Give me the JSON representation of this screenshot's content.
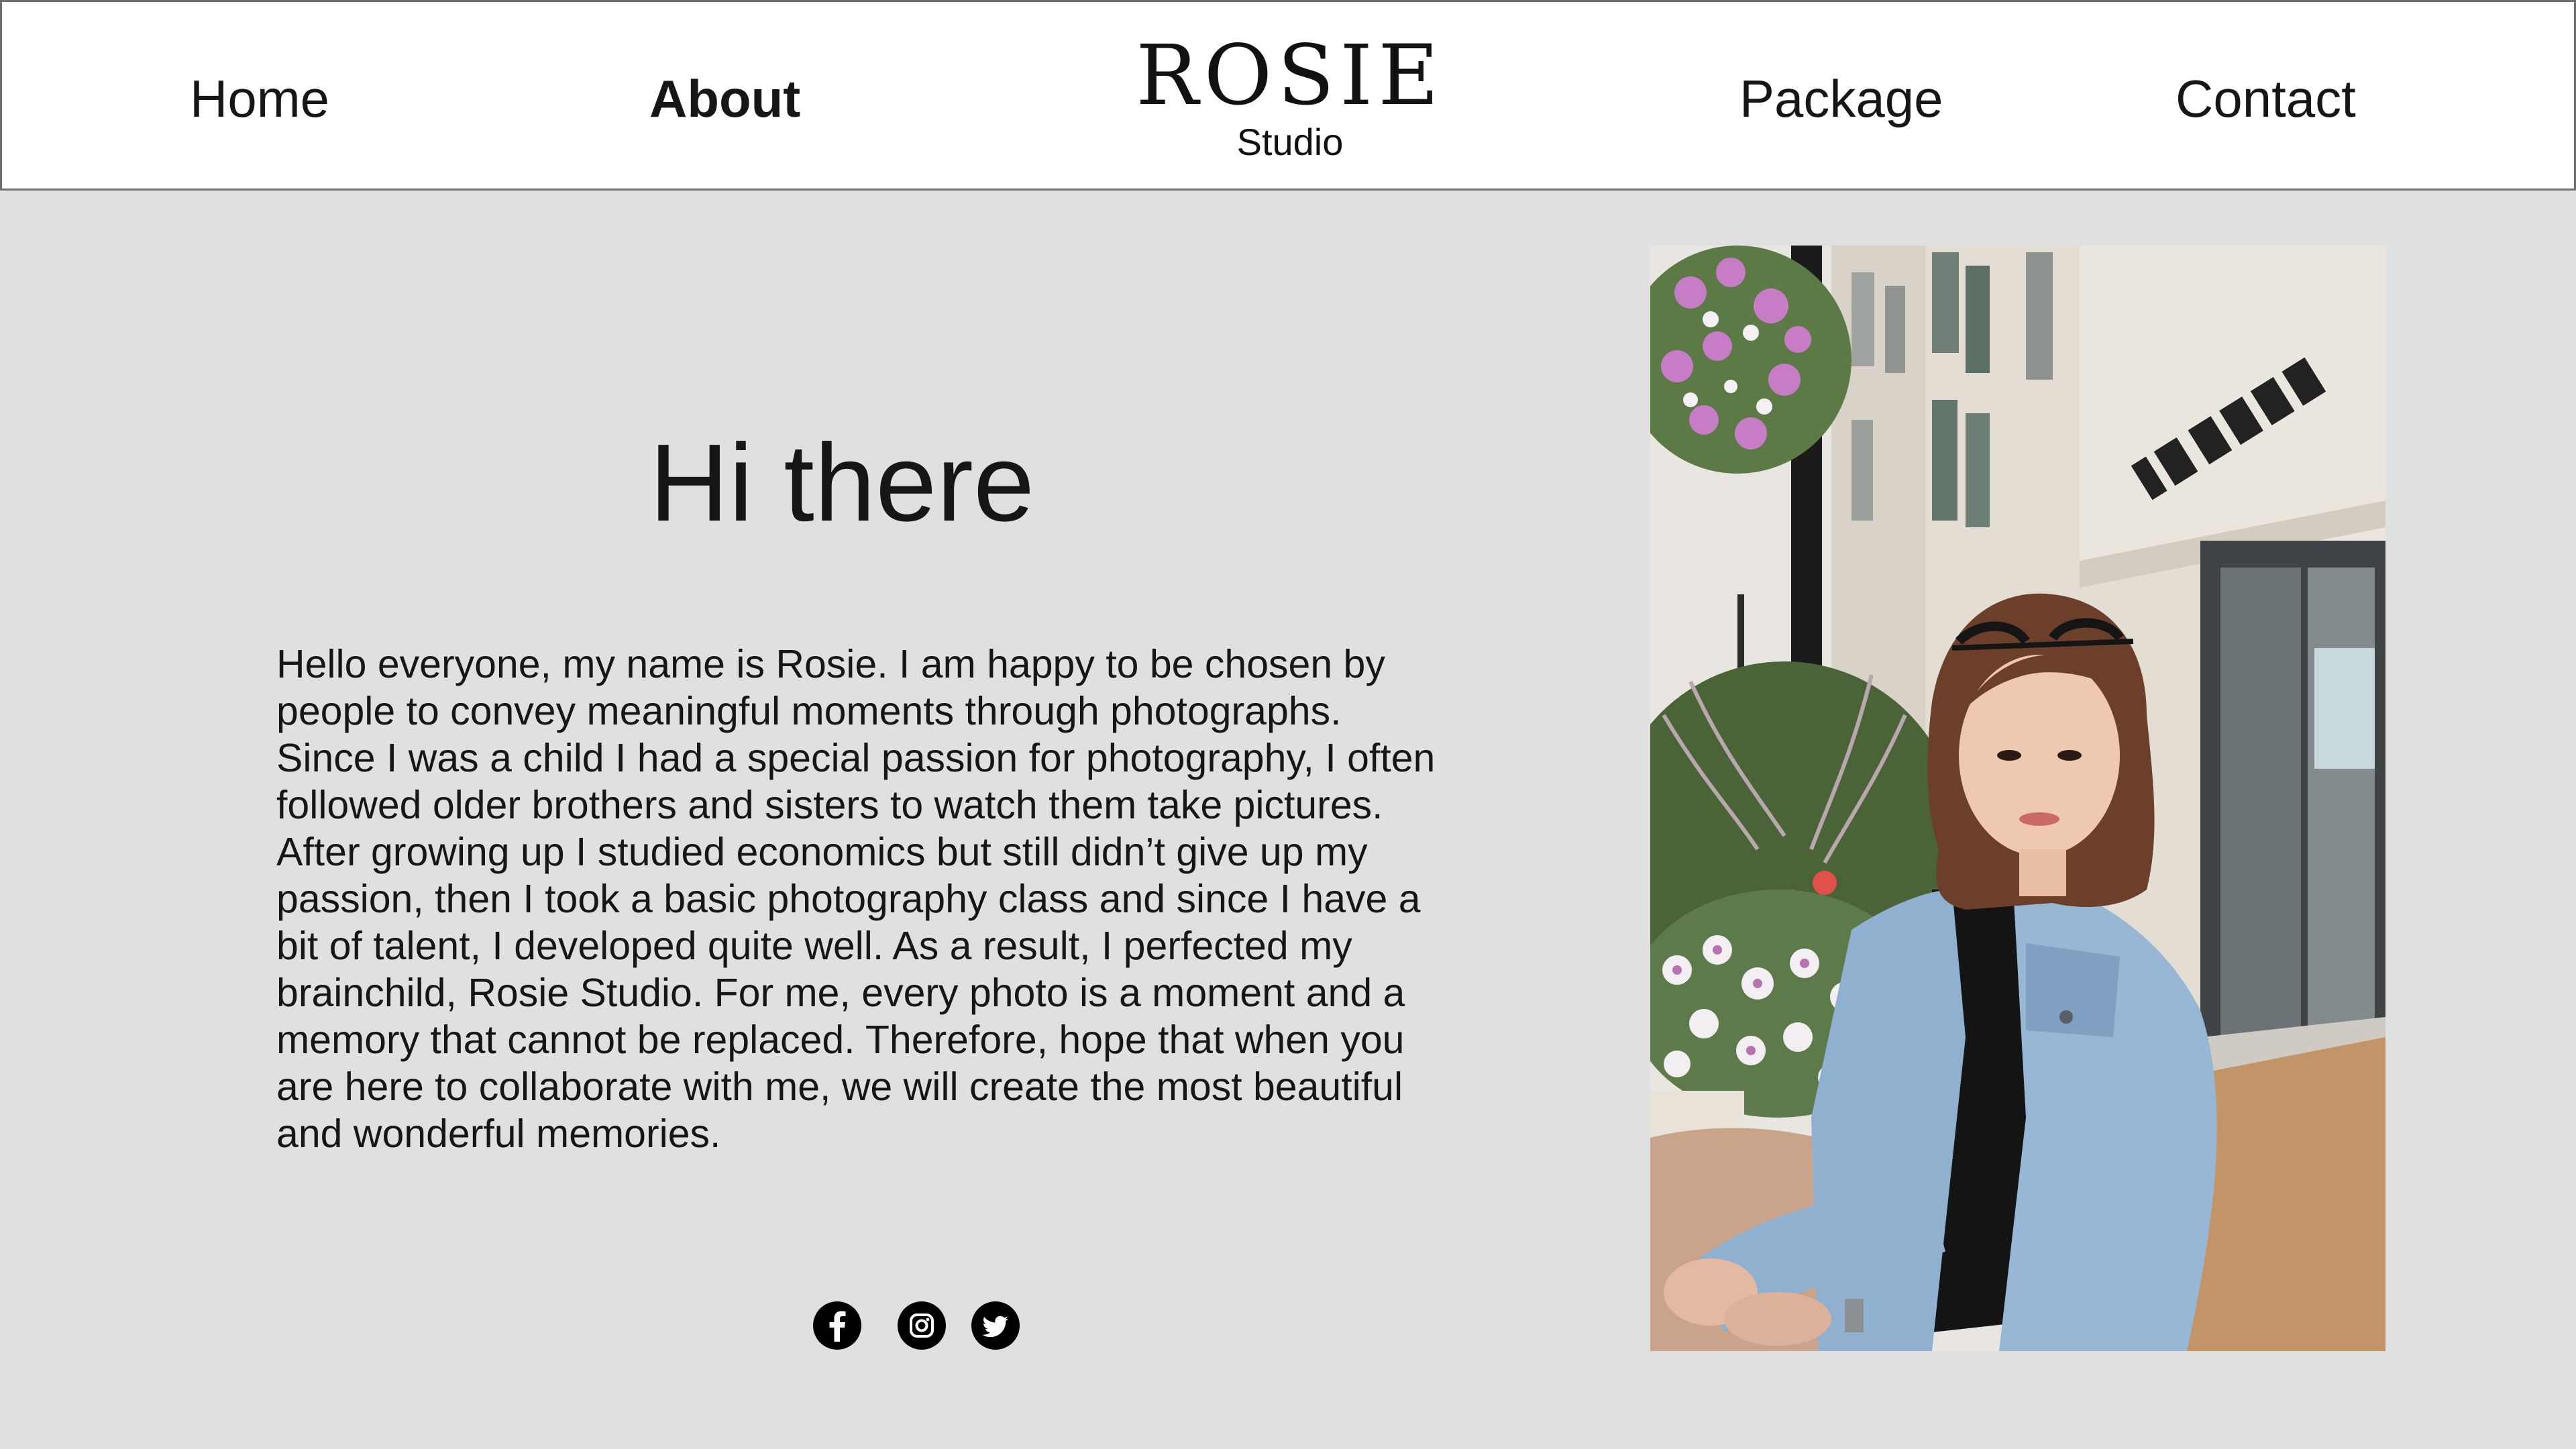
{
  "nav": {
    "home": "Home",
    "about": "About",
    "package": "Package",
    "contact": "Contact",
    "active": "About"
  },
  "logo": {
    "title": "ROSIE",
    "subtitle": "Studio"
  },
  "main": {
    "heading": "Hi there",
    "bio": "Hello everyone, my name is Rosie. I am happy to be chosen by people to convey meaningful moments through photographs. Since I was a child I had a special passion for photography, I often followed older brothers and sisters to watch them take pictures. After growing up I studied economics but still didn’t give up my passion, then I took a basic photography class and since I have a bit of talent, I developed quite well. As a result, I perfected my brainchild, Rosie Studio. For me, every photo is a moment and a memory that cannot be replaced. Therefore, hope that when you are here to collaborate with me, we will create the most beautiful and wonderful memories."
  },
  "socials": [
    {
      "name": "Facebook",
      "icon": "facebook-icon"
    },
    {
      "name": "Instagram",
      "icon": "instagram-icon"
    },
    {
      "name": "Twitter",
      "icon": "twitter-icon"
    }
  ],
  "colors": {
    "page_background": "#e0e0e0",
    "header_background": "#ffffff",
    "text": "#161616",
    "icon_fill": "#000000"
  }
}
